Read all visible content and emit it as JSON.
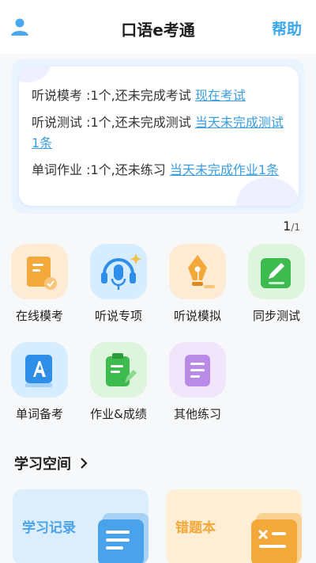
{
  "header": {
    "title": "口语e考通",
    "help_label": "帮助",
    "avatar_icon": "user-avatar-icon"
  },
  "notice": {
    "items": [
      {
        "text": "听说模考 :1个,还未完成考试 ",
        "link": "现在考试"
      },
      {
        "text": "听说测试 :1个,还未完成测试 ",
        "link": "当天未完成测试1条"
      },
      {
        "text": "单词作业 :1个,还未练习 ",
        "link": "当天未完成作业1条"
      }
    ],
    "pager_current": "1",
    "pager_total": "/1"
  },
  "grid": {
    "items": [
      {
        "label": "在线模考",
        "icon": "exam-document-icon"
      },
      {
        "label": "听说专项",
        "icon": "headset-microphone-icon"
      },
      {
        "label": "听说模拟",
        "icon": "fountain-pen-icon"
      },
      {
        "label": "同步测试",
        "icon": "edit-note-icon"
      },
      {
        "label": "单词备考",
        "icon": "letter-a-book-icon"
      },
      {
        "label": "作业&成绩",
        "icon": "clipboard-icon"
      },
      {
        "label": "其他练习",
        "icon": "list-document-icon"
      }
    ]
  },
  "study_space": {
    "title": "学习空间",
    "cards": [
      {
        "label": "学习记录",
        "icon": "record-list-icon"
      },
      {
        "label": "错题本",
        "icon": "wrong-answer-book-icon"
      }
    ]
  },
  "colors": {
    "accent": "#3aa7f0",
    "link": "#3b9de0",
    "orange": "#f3a83a",
    "blue": "#2f8fe8",
    "green": "#3dbb4e",
    "purple": "#b98ae6"
  }
}
